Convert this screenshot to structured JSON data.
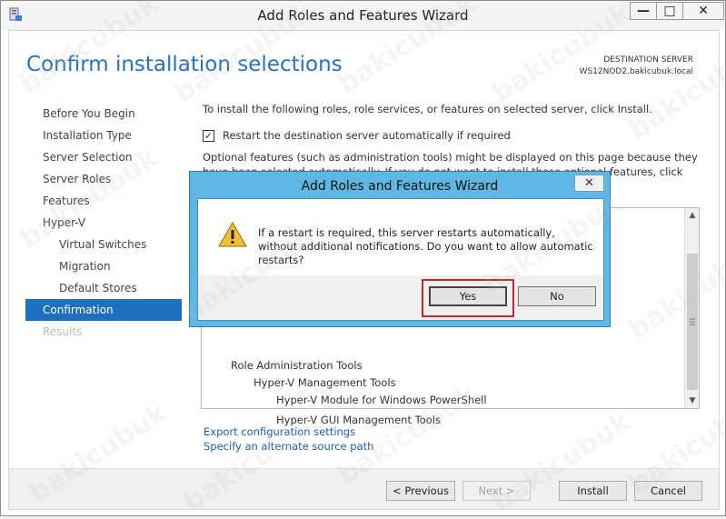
{
  "window": {
    "title": "Add Roles and Features Wizard",
    "minimize_label": "—",
    "maximize_label": "□",
    "close_label": "✕"
  },
  "page": {
    "title": "Confirm installation selections",
    "destination_label": "DESTINATION SERVER",
    "destination_server": "WS12NOD2.bakicubuk.local"
  },
  "nav": [
    {
      "label": "Before You Begin"
    },
    {
      "label": "Installation Type"
    },
    {
      "label": "Server Selection"
    },
    {
      "label": "Server Roles"
    },
    {
      "label": "Features"
    },
    {
      "label": "Hyper-V"
    },
    {
      "label": "Virtual Switches"
    },
    {
      "label": "Migration"
    },
    {
      "label": "Default Stores"
    },
    {
      "label": "Confirmation"
    },
    {
      "label": "Results"
    }
  ],
  "main": {
    "intro": "To install the following roles, role services, or features on selected server, click Install.",
    "restart_checkbox_label": "Restart the destination server automatically if required",
    "restart_checked": "✓",
    "optional_text": "Optional features (such as administration tools) might be displayed on this page because they have been selected automatically. If you do not want to install these optional features, click Previous to clear their check boxes.",
    "list_items": [
      "Role Administration Tools",
      "Hyper-V Management Tools",
      "Hyper-V Module for Windows PowerShell",
      "Hyper-V GUI Management Tools"
    ],
    "scroll_up": "▲",
    "scroll_down": "▼",
    "export_link": "Export configuration settings",
    "alternate_link": "Specify an alternate source path"
  },
  "footer": {
    "previous": "< Previous",
    "next": "Next >",
    "install": "Install",
    "cancel": "Cancel"
  },
  "dialog": {
    "title": "Add Roles and Features Wizard",
    "close_label": "✕",
    "message": "If a restart is required, this server restarts automatically, without additional notifications. Do you want to allow automatic restarts?",
    "yes": "Yes",
    "no": "No"
  },
  "watermark": "bakicubuk",
  "colors": {
    "title_blue": "#2a72b8",
    "nav_active": "#1e6fc0",
    "dialog_frame": "#5eb8e3",
    "highlight_red": "#c0282d",
    "link_blue": "#1e5fb0"
  }
}
